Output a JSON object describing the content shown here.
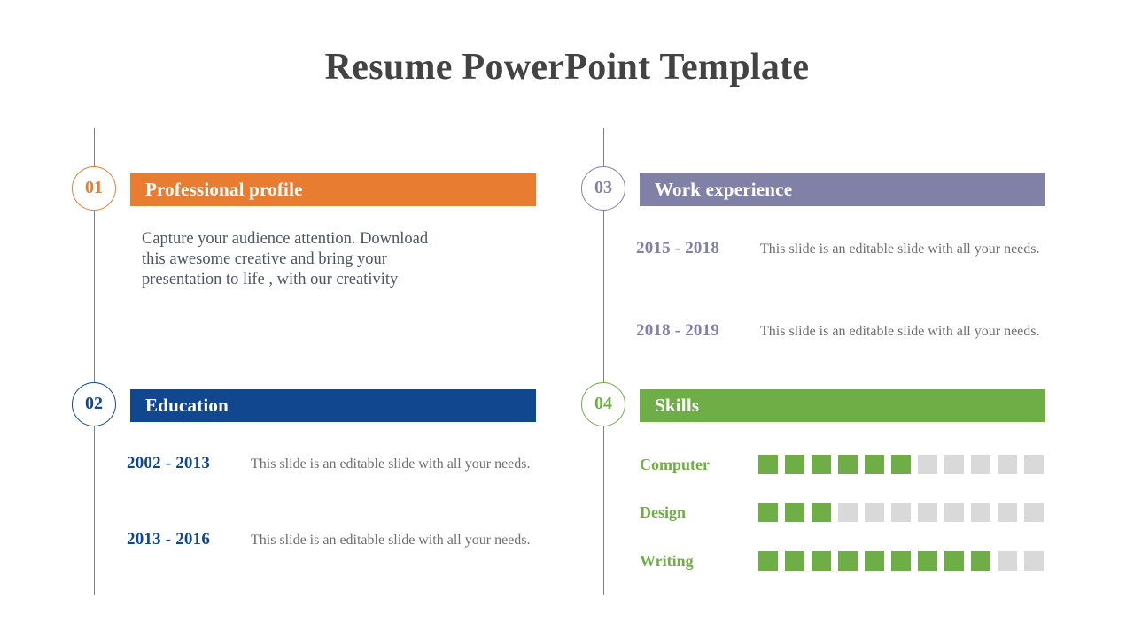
{
  "slide": {
    "title": "Resume PowerPoint Template",
    "title_color": "#434343",
    "background": "#ffffff"
  },
  "colors": {
    "orange": "#E87D32",
    "blue": "#10478E",
    "purple": "#8181A8",
    "green": "#6FAE46",
    "rail": "#808080",
    "meter_empty": "#d9d9d9",
    "body_text": "#4c5663",
    "desc_text": "#6e6e6e"
  },
  "sections": [
    {
      "number": "01",
      "title": "Professional profile",
      "color": "#E87D32",
      "body": "Capture your audience attention. Download this awesome creative and bring your presentation to life , with our creativity"
    },
    {
      "number": "02",
      "title": "Education",
      "color": "#10478E",
      "entries": [
        {
          "date": "2002 - 2013",
          "desc": "This slide is an editable slide with all your needs."
        },
        {
          "date": "2013 - 2016",
          "desc": "This slide is an editable slide with all your needs."
        }
      ]
    },
    {
      "number": "03",
      "title": "Work experience",
      "color": "#8181A8",
      "entries": [
        {
          "date": "2015 - 2018",
          "desc": "This slide is an editable slide with all your needs."
        },
        {
          "date": "2018 - 2019",
          "desc": "This slide is an editable slide with all your needs."
        }
      ]
    },
    {
      "number": "04",
      "title": "Skills",
      "color": "#6FAE46",
      "skills": [
        {
          "name": "Computer",
          "filled": 6,
          "total": 11
        },
        {
          "name": "Design",
          "filled": 3,
          "total": 11
        },
        {
          "name": "Writing",
          "filled": 9,
          "total": 11
        }
      ]
    }
  ]
}
